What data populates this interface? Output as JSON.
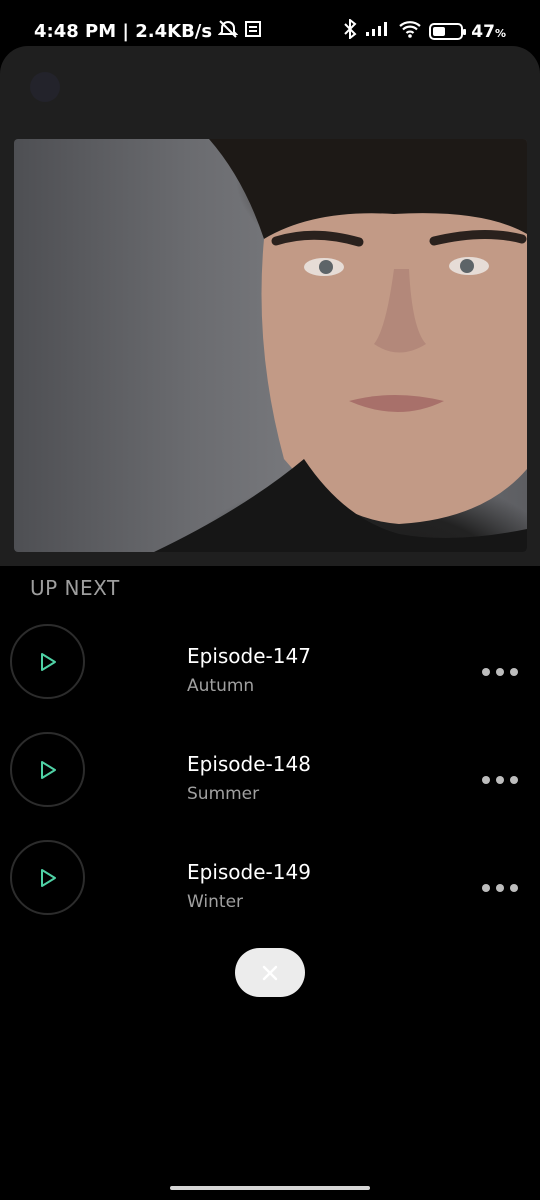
{
  "status_bar": {
    "time_speed": "4:48 PM | 2.4KB/s",
    "battery_percent": "47",
    "battery_unit": "%",
    "battery_level": 0.47,
    "icons": [
      "alarm-off-icon",
      "notes-icon",
      "bluetooth-icon",
      "signal-icon",
      "wifi-icon",
      "battery-icon"
    ]
  },
  "player": {
    "collapse_icon": "chevron-down-icon",
    "artwork_description_icon": "album-art"
  },
  "up_next": {
    "heading": "UP NEXT",
    "episodes": [
      {
        "title": "Episode-147",
        "subtitle": "Autumn"
      },
      {
        "title": "Episode-148",
        "subtitle": "Summer"
      },
      {
        "title": "Episode-149",
        "subtitle": "Winter"
      }
    ]
  },
  "colors": {
    "accent": "#4fd1a5",
    "background": "#000000",
    "card": "#1f1f1f"
  }
}
